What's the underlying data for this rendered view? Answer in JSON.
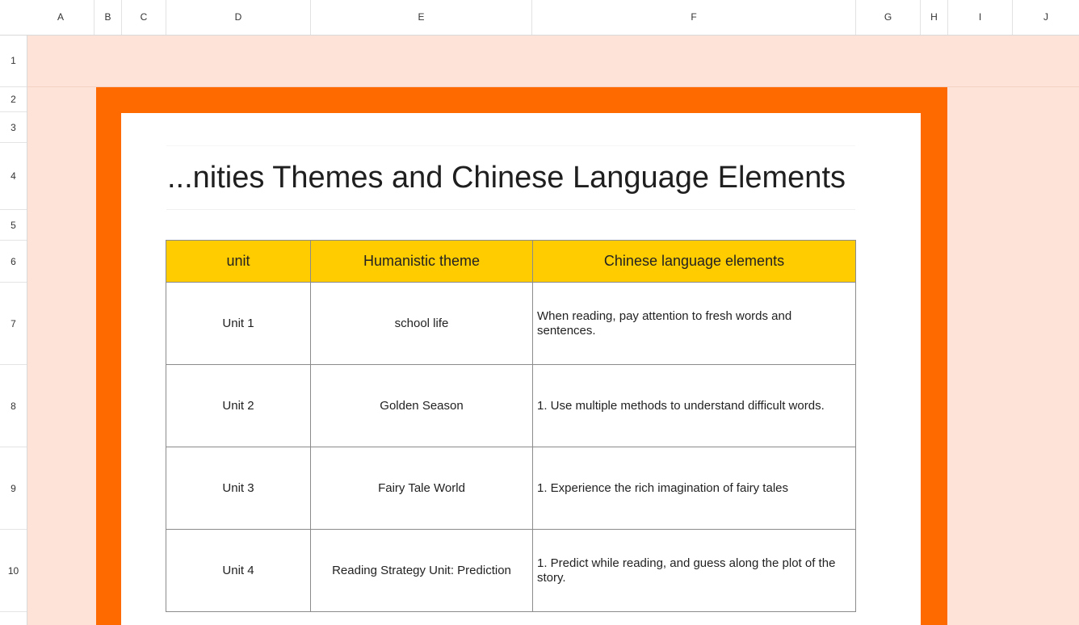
{
  "columns": [
    "A",
    "B",
    "C",
    "D",
    "E",
    "F",
    "G",
    "H",
    "I",
    "J"
  ],
  "rows": [
    "1",
    "2",
    "3",
    "4",
    "5",
    "6",
    "7",
    "8",
    "9",
    "10"
  ],
  "title": "...nities Themes and Chinese Language Elements",
  "table": {
    "headers": [
      "unit",
      "Humanistic theme",
      "Chinese language elements"
    ],
    "rows": [
      {
        "unit": "Unit 1",
        "theme": "school life",
        "elements": "When reading, pay attention to fresh words and sentences."
      },
      {
        "unit": "Unit 2",
        "theme": "Golden Season",
        "elements": "1. Use multiple methods to understand difficult words."
      },
      {
        "unit": "Unit 3",
        "theme": "Fairy Tale World",
        "elements": "1. Experience the rich imagination of fairy tales"
      },
      {
        "unit": "Unit 4",
        "theme": "Reading Strategy Unit: Prediction",
        "elements": "1. Predict while reading, and guess along the plot of the story."
      }
    ]
  },
  "colors": {
    "sheet_bg": "#fde3d8",
    "frame": "#ff6a00",
    "header_fill": "#ffcc00",
    "accent_text": "#b8356b"
  },
  "icons": [
    "eye-icon",
    "freeze-columns-icon",
    "freeze-rows-icon"
  ]
}
